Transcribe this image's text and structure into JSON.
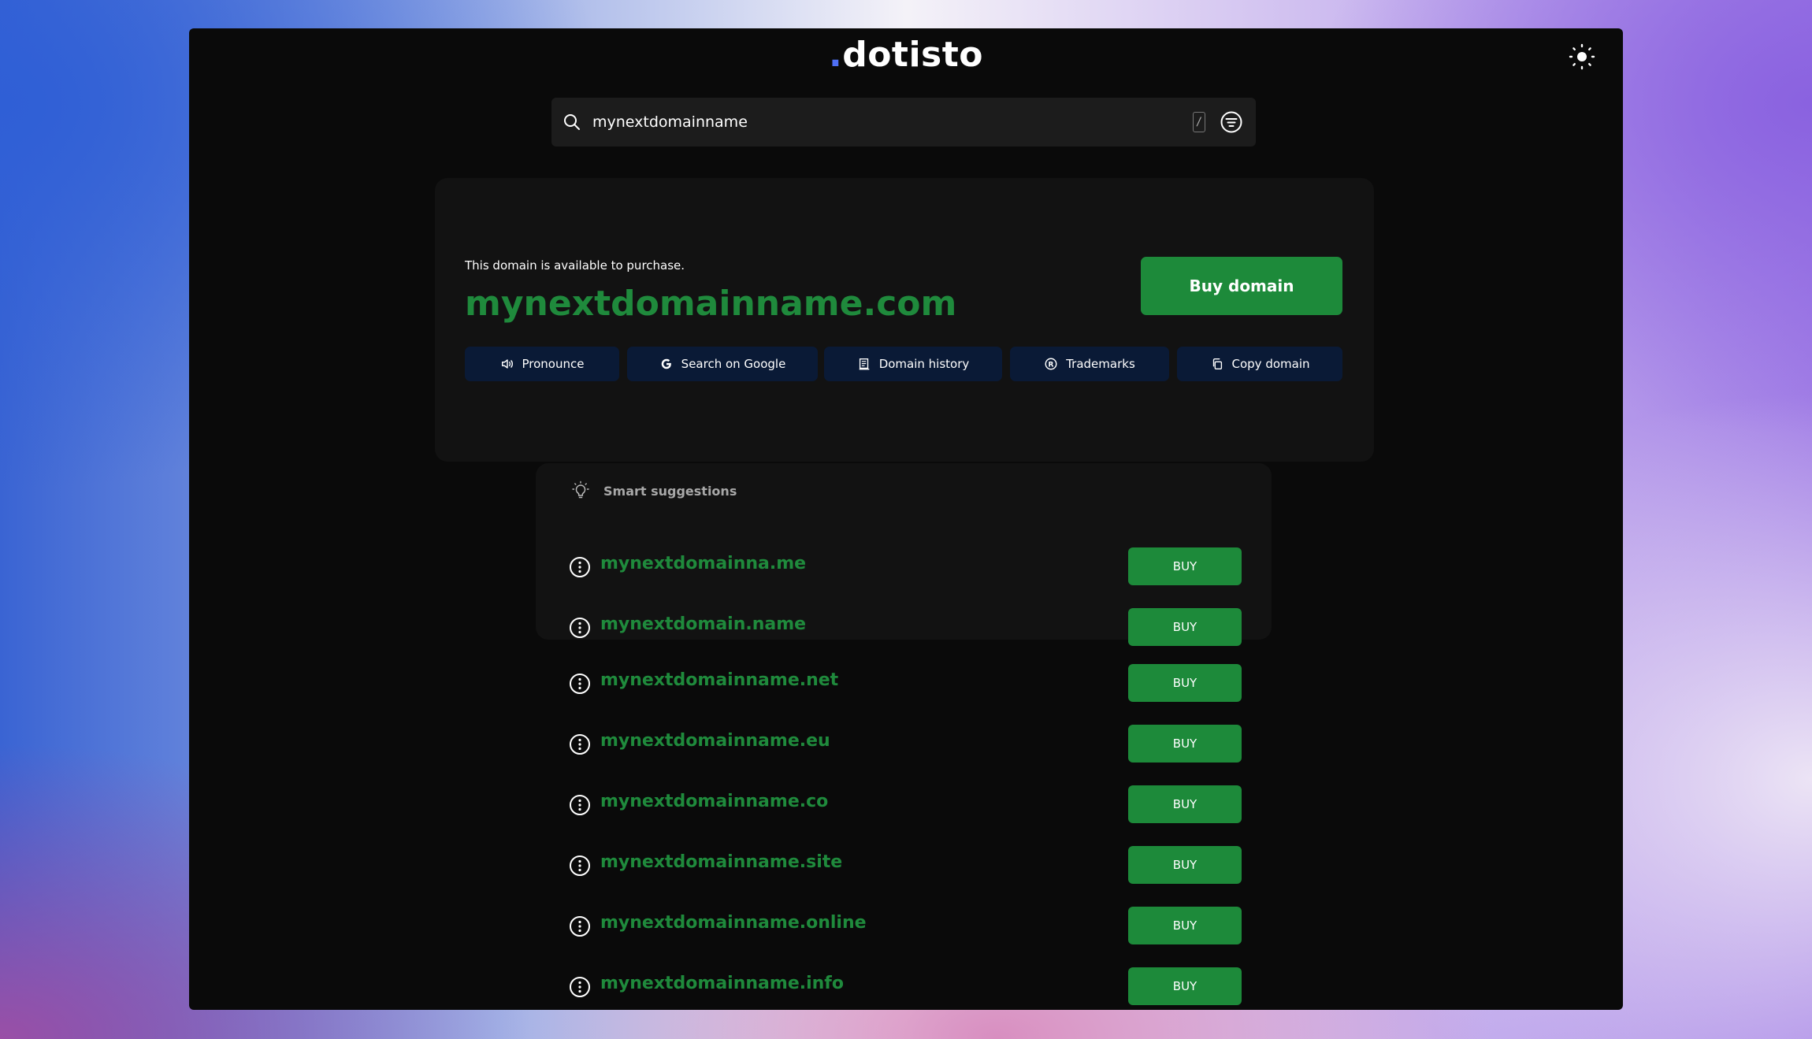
{
  "logo": {
    "dot": ".",
    "text": "dotisto"
  },
  "search": {
    "value": "mynextdomainname",
    "shortcut": "/"
  },
  "result": {
    "availability_text": "This domain is available to purchase.",
    "domain": "mynextdomainname.com",
    "buy_label": "Buy domain",
    "actions": [
      {
        "label": "Pronounce",
        "icon": "speaker-icon"
      },
      {
        "label": "Search on Google",
        "icon": "google-icon"
      },
      {
        "label": "Domain history",
        "icon": "history-icon"
      },
      {
        "label": "Trademarks",
        "icon": "registered-icon"
      },
      {
        "label": "Copy domain",
        "icon": "copy-icon"
      }
    ]
  },
  "smart_suggestions": {
    "title": "Smart suggestions",
    "items": [
      {
        "domain": "mynextdomainna.me",
        "buy_label": "BUY"
      },
      {
        "domain": "mynextdomain.name",
        "buy_label": "BUY"
      }
    ]
  },
  "alternatives": [
    {
      "domain": "mynextdomainname.net",
      "buy_label": "BUY"
    },
    {
      "domain": "mynextdomainname.eu",
      "buy_label": "BUY"
    },
    {
      "domain": "mynextdomainname.co",
      "buy_label": "BUY"
    },
    {
      "domain": "mynextdomainname.site",
      "buy_label": "BUY"
    },
    {
      "domain": "mynextdomainname.online",
      "buy_label": "BUY"
    },
    {
      "domain": "mynextdomainname.info",
      "buy_label": "BUY"
    }
  ],
  "colors": {
    "accent_green": "#1d8a3a",
    "domain_green": "#1f8a3c",
    "action_bg": "#0a1a36",
    "logo_dot": "#4f6ff5"
  }
}
